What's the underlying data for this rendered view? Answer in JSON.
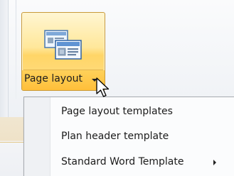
{
  "ribbon": {
    "button": {
      "label": "Page layout",
      "icon": "page-layout-icon",
      "state": "highlighted",
      "accent": "#ffd567"
    }
  },
  "menu": {
    "items": [
      {
        "label": "Page layout templates",
        "has_submenu": false
      },
      {
        "label": "Plan header template",
        "has_submenu": false
      },
      {
        "label": "Standard Word Template",
        "has_submenu": true
      }
    ]
  }
}
